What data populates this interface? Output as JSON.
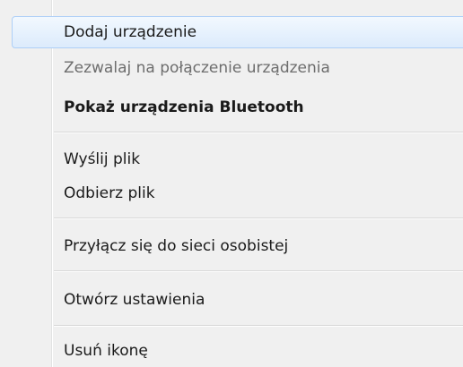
{
  "menu": {
    "items": [
      {
        "label": "Dodaj urządzenie"
      },
      {
        "label": "Zezwalaj na połączenie urządzenia"
      },
      {
        "label": "Pokaż urządzenia Bluetooth"
      },
      {
        "label": "Wyślij plik"
      },
      {
        "label": "Odbierz plik"
      },
      {
        "label": "Przyłącz się do sieci osobistej"
      },
      {
        "label": "Otwórz ustawienia"
      },
      {
        "label": "Usuń ikonę"
      }
    ]
  }
}
